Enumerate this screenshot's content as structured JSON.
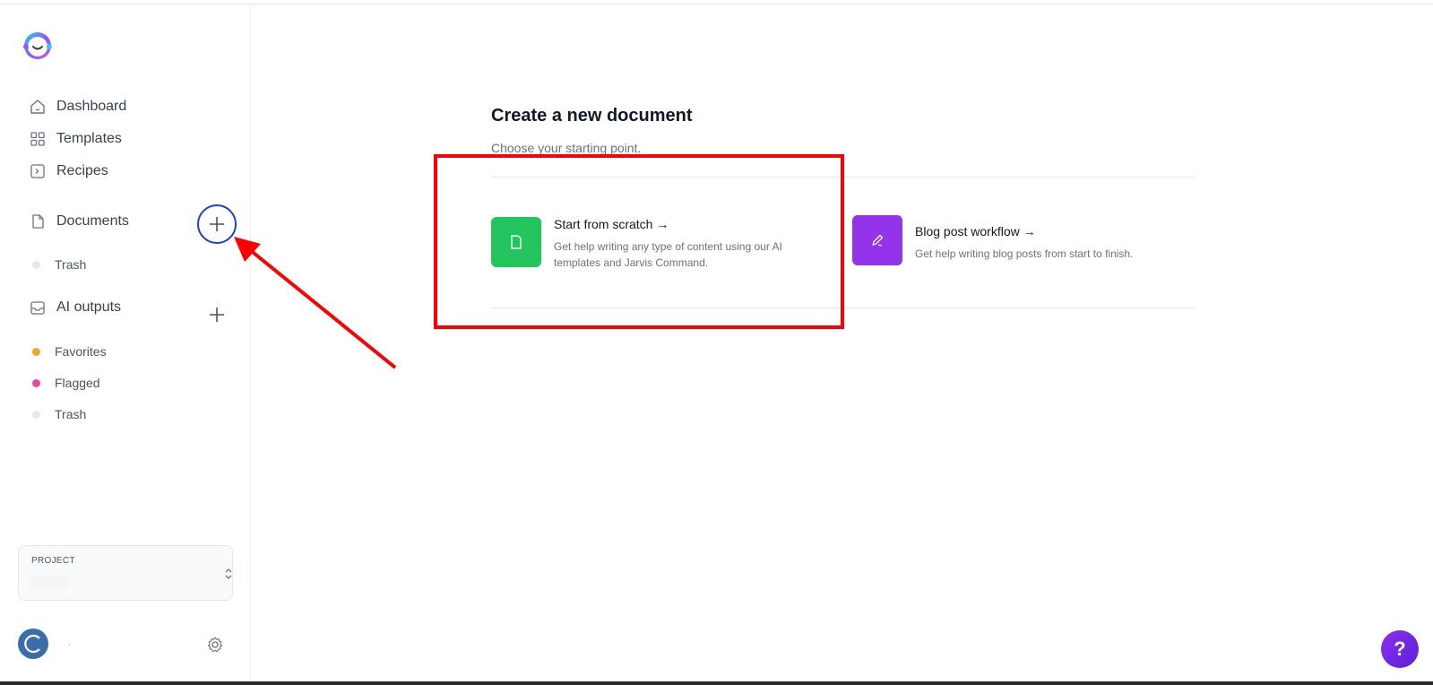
{
  "sidebar": {
    "nav": [
      {
        "label": "Dashboard",
        "icon": "home-icon"
      },
      {
        "label": "Templates",
        "icon": "grid-icon"
      },
      {
        "label": "Recipes",
        "icon": "terminal-icon"
      }
    ],
    "documents": {
      "label": "Documents",
      "icon": "document-icon",
      "items": [
        {
          "label": "Trash",
          "dot_color": "#e5e7eb"
        }
      ]
    },
    "ai_outputs": {
      "label": "AI outputs",
      "icon": "inbox-icon",
      "items": [
        {
          "label": "Favorites",
          "dot_color": "#f5a623"
        },
        {
          "label": "Flagged",
          "dot_color": "#ec4899"
        },
        {
          "label": "Trash",
          "dot_color": "#e5e7eb"
        }
      ]
    },
    "project": {
      "label": "PROJECT",
      "value": ""
    },
    "user": {
      "name": "."
    }
  },
  "main": {
    "title": "Create a new document",
    "subtitle": "Choose your starting point.",
    "cards": [
      {
        "title": "Start from scratch →",
        "description_line1": "Get help writing any type of content using our AI",
        "description_line2": "templates and Jarvis Command.",
        "color": "#22c55e",
        "icon": "file-icon"
      },
      {
        "title": "Blog post workflow →",
        "description_line1": "Get help writing blog posts from start to finish.",
        "color": "#9333ea",
        "icon": "pencil-icon"
      }
    ]
  },
  "help": {
    "label": "?"
  },
  "colors": {
    "annotation_red": "#ff0000",
    "highlight_blue": "#1d3fd8"
  }
}
